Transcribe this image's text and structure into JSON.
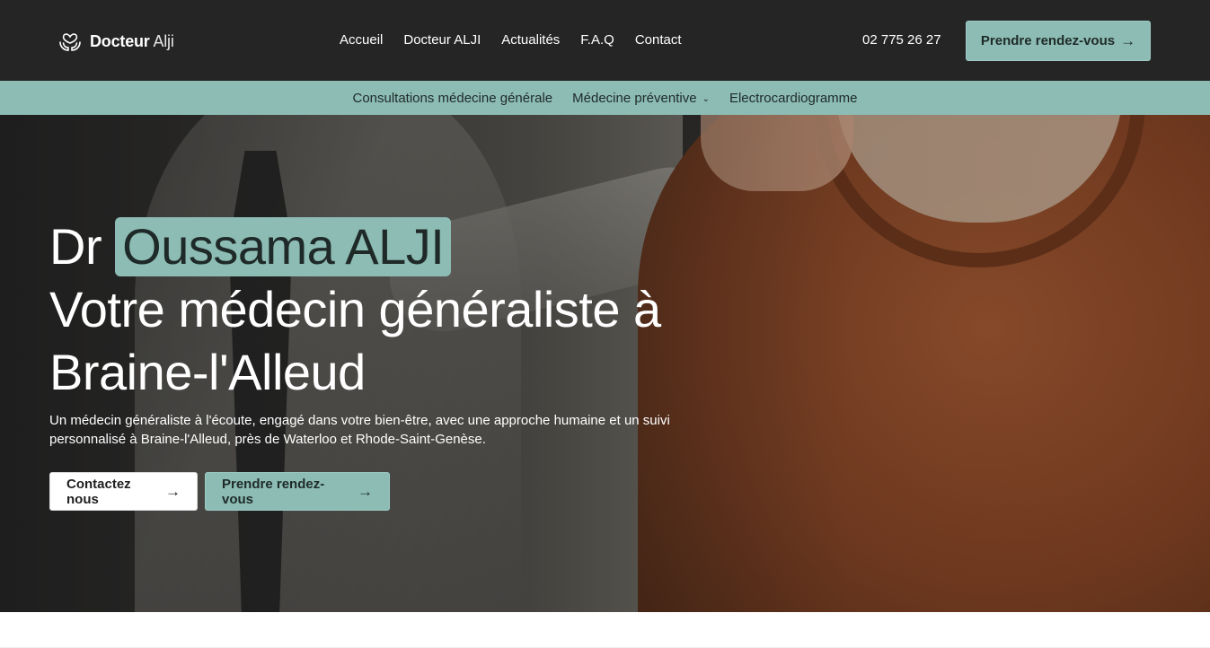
{
  "brand": {
    "name_bold": "Docteur",
    "name_light": "Alji",
    "icon": "heart-hands-icon"
  },
  "nav": {
    "items": [
      {
        "label": "Accueil"
      },
      {
        "label": "Docteur ALJI"
      },
      {
        "label": "Actualités"
      },
      {
        "label": "F.A.Q"
      },
      {
        "label": "Contact"
      }
    ],
    "phone": "02 775 26 27",
    "cta_label": "Prendre rendez-vous",
    "cta_icon": "arrow-right-icon"
  },
  "subnav": {
    "items": [
      {
        "label": "Consultations médecine générale"
      },
      {
        "label": "Médecine préventive",
        "icon": "chevron-down-icon"
      },
      {
        "label": "Electrocardiogramme"
      }
    ]
  },
  "hero": {
    "title_prefix": "Dr",
    "title_highlight": "Oussama ALJI",
    "title_line2": "Votre médecin généraliste à",
    "title_line3": "Braine-l'Alleud",
    "description_line1": "Un médecin généraliste à l'écoute, engagé dans votre bien-être, avec une approche humaine et un suivi",
    "description_line2": "personnalisé à Braine-l'Alleud, près de Waterloo et Rhode-Saint-Genèse.",
    "contact_label": "Contactez nous",
    "appointment_label": "Prendre rendez-vous"
  },
  "colors": {
    "header_bg": "#252525",
    "accent": "#8cbcb4",
    "text_on_accent": "#1f2a28"
  }
}
